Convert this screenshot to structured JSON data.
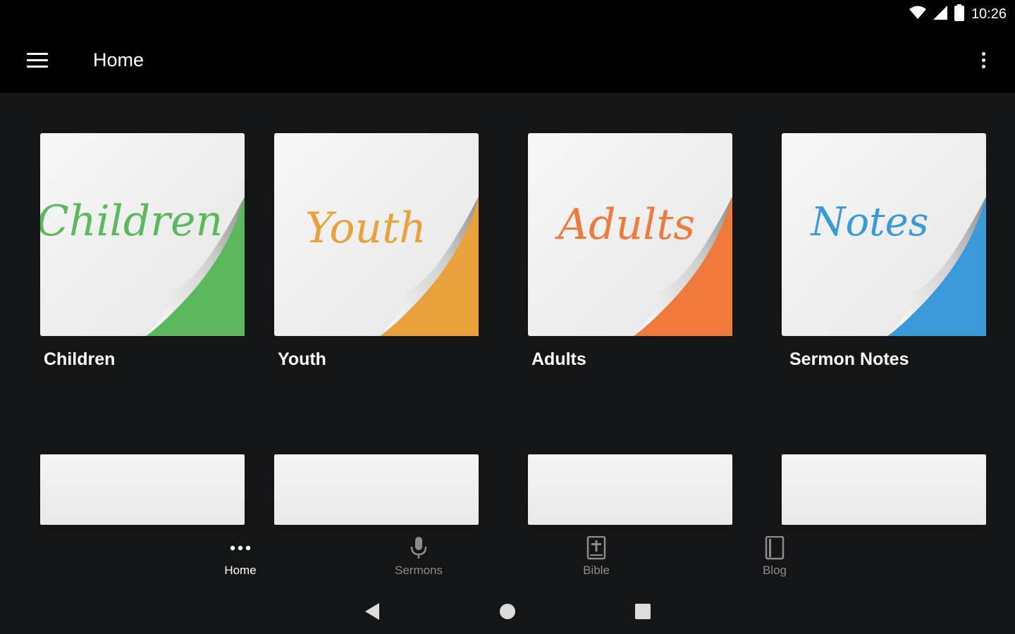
{
  "status_bar": {
    "time": "10:26",
    "icons": [
      "wifi-icon",
      "signal-icon",
      "battery-icon"
    ]
  },
  "app_bar": {
    "title": "Home",
    "menu_icon": "hamburger-menu-icon",
    "overflow_icon": "more-vert-icon"
  },
  "tiles": [
    {
      "caption": "Children",
      "art_text": "Children",
      "accent": "#5cb85c"
    },
    {
      "caption": "Youth",
      "art_text": "Youth",
      "accent": "#e9a23b"
    },
    {
      "caption": "Adults",
      "art_text": "Adults",
      "accent": "#ef7a3b"
    },
    {
      "caption": "Sermon Notes",
      "art_text": "Notes",
      "accent": "#3a9ad9"
    }
  ],
  "bottom_nav": {
    "items": [
      {
        "label": "Home",
        "icon": "more-horiz-icon",
        "active": true
      },
      {
        "label": "Sermons",
        "icon": "microphone-icon",
        "active": false
      },
      {
        "label": "Bible",
        "icon": "bible-icon",
        "active": false
      },
      {
        "label": "Blog",
        "icon": "book-icon",
        "active": false
      }
    ]
  },
  "system_nav": {
    "icons": [
      "back-icon",
      "home-icon",
      "recents-icon"
    ]
  },
  "colors": {
    "background": "#141517",
    "bar": "#000000",
    "inactive_label": "#8c8c8c"
  }
}
